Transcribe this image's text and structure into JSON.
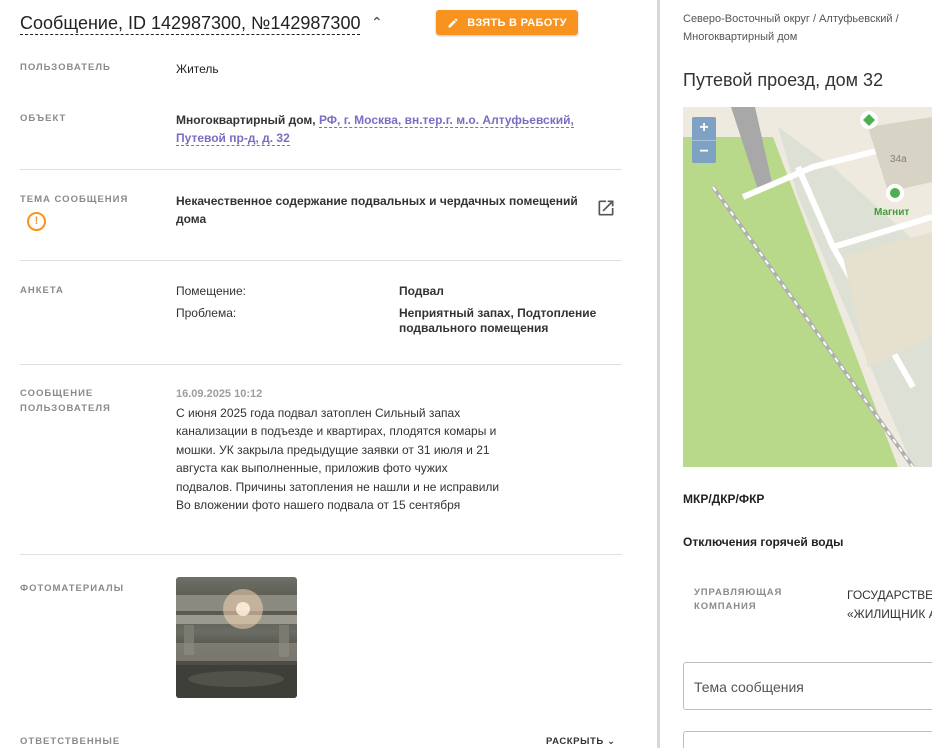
{
  "header": {
    "title": "Сообщение, ID 142987300, №142987300",
    "take_button": "ВЗЯТЬ В РАБОТУ",
    "accent": "#f7931e"
  },
  "fields": {
    "user_label": "ПОЛЬЗОВАТЕЛЬ",
    "user_value": "Житель",
    "object_label": "ОБЪЕКТ",
    "object_type": "Многоквартирный дом,",
    "object_link": "РФ, г. Москва, вн.тер.г. м.о. Алтуфьевский, Путевой пр-д, д. 32",
    "topic_label": "ТЕМА СООБЩЕНИЯ",
    "topic_value": "Некачественное содержание подвальных и чердачных помещений дома",
    "form_label": "АНКЕТА",
    "form_room_key": "Помещение:",
    "form_room_value": "Подвал",
    "form_problem_key": "Проблема:",
    "form_problem_value": "Неприятный запах, Подтопление подвального помещения",
    "message_label": "СООБЩЕНИЕ ПОЛЬЗОВАТЕЛЯ",
    "message_date": "16.09.2025 10:12",
    "message_text": "С июня 2025 года подвал затоплен Сильный запах канализации в подъезде и квартирах, плодятся комары и мошки. УК закрыла предыдущие заявки от 31 июля и 21 августа как выполненные, приложив фото чужих подвалов. Причины затопления не нашли и не исправили Во вложении фото нашего подвала от 15 сентября",
    "photos_label": "ФОТОМАТЕРИАЛЫ",
    "responsible_label": "ОТВЕТСТВЕННЫЕ",
    "expand_label": "РАСКРЫТЬ"
  },
  "sidebar": {
    "breadcrumb": "Северо-Восточный округ / Алтуфьевский / Многоквартирный дом",
    "address": "Путевой проезд, дом 32",
    "map": {
      "zoom_in": "+",
      "zoom_out": "−",
      "building_number": "34а",
      "poi_label": "Магнит"
    },
    "mkr": "МКР/ДКР/ФКР",
    "hot_water": "Отключения горячей воды",
    "company_label": "УПРАВЛЯЮЩАЯ КОМПАНИЯ",
    "company_value_1": "ГОСУДАРСТВЕ",
    "company_value_2": "«ЖИЛИЩНИК А",
    "topic_placeholder": "Тема сообщения"
  }
}
